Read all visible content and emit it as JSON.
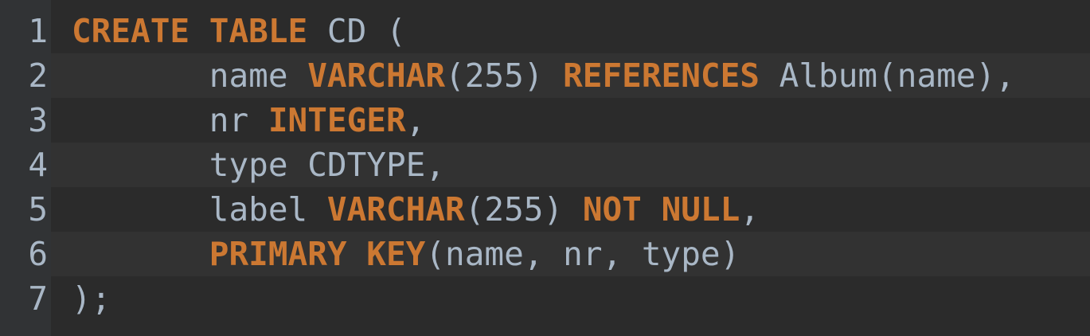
{
  "editor": {
    "colors": {
      "background": "#2b2b2b",
      "stripe": "#323232",
      "gutter": "#313335",
      "keyword": "#cc7832",
      "text": "#a9b7c6"
    },
    "lines": [
      {
        "number": "1",
        "tokens": [
          {
            "text": "CREATE",
            "type": "kw"
          },
          {
            "text": " ",
            "type": "plain"
          },
          {
            "text": "TABLE",
            "type": "kw"
          },
          {
            "text": " CD (",
            "type": "plain"
          }
        ]
      },
      {
        "number": "2",
        "tokens": [
          {
            "text": "       name ",
            "type": "plain"
          },
          {
            "text": "VARCHAR",
            "type": "kw"
          },
          {
            "text": "(255) ",
            "type": "plain"
          },
          {
            "text": "REFERENCES",
            "type": "kw"
          },
          {
            "text": " Album(name),",
            "type": "plain"
          }
        ]
      },
      {
        "number": "3",
        "tokens": [
          {
            "text": "       nr ",
            "type": "plain"
          },
          {
            "text": "INTEGER",
            "type": "kw"
          },
          {
            "text": ",",
            "type": "plain"
          }
        ]
      },
      {
        "number": "4",
        "tokens": [
          {
            "text": "       type CDTYPE,",
            "type": "plain"
          }
        ]
      },
      {
        "number": "5",
        "tokens": [
          {
            "text": "       label ",
            "type": "plain"
          },
          {
            "text": "VARCHAR",
            "type": "kw"
          },
          {
            "text": "(255) ",
            "type": "plain"
          },
          {
            "text": "NOT",
            "type": "kw"
          },
          {
            "text": " ",
            "type": "plain"
          },
          {
            "text": "NULL",
            "type": "kw"
          },
          {
            "text": ",",
            "type": "plain"
          }
        ]
      },
      {
        "number": "6",
        "tokens": [
          {
            "text": "       ",
            "type": "plain"
          },
          {
            "text": "PRIMARY",
            "type": "kw"
          },
          {
            "text": " ",
            "type": "plain"
          },
          {
            "text": "KEY",
            "type": "kw"
          },
          {
            "text": "(name, nr, type)",
            "type": "plain"
          }
        ]
      },
      {
        "number": "7",
        "tokens": [
          {
            "text": ");",
            "type": "plain"
          }
        ]
      }
    ]
  }
}
